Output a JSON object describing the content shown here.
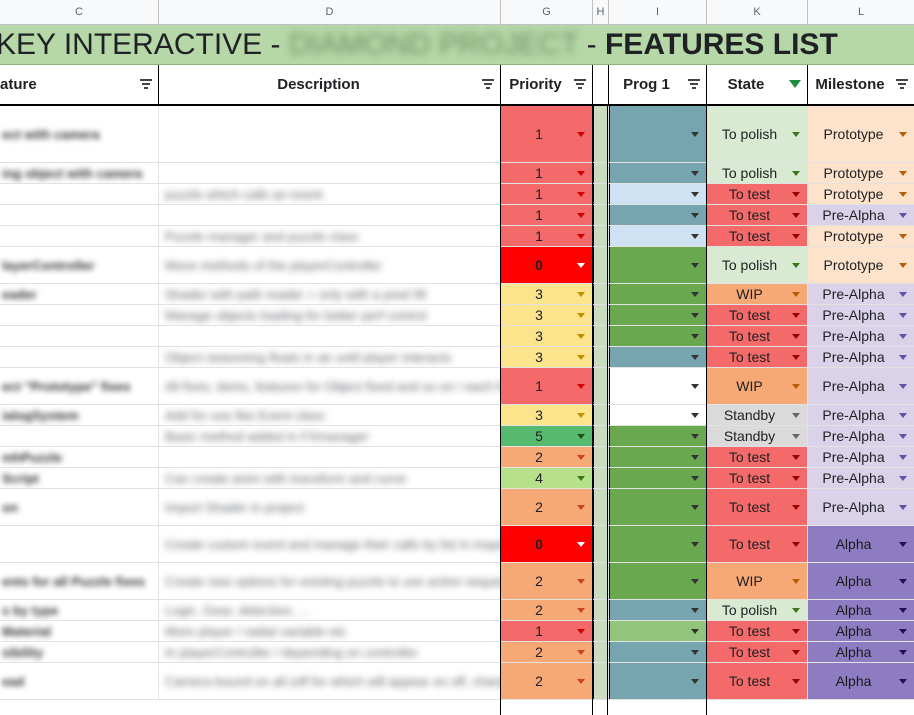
{
  "columns": {
    "letters": [
      "C",
      "D",
      "G",
      "H",
      "I",
      "K",
      "L"
    ]
  },
  "title": {
    "prefix": "KEY INTERACTIVE - ",
    "blurred": "DIAMOND PROJECT",
    "suffix_dash": " - ",
    "suffix": "FEATURES LIST"
  },
  "headers": {
    "feature": "ature",
    "description": "Description",
    "priority": "Priority",
    "prog1": "Prog 1",
    "state": "State",
    "milestone": "Milestone"
  },
  "colors": {
    "title_band": "#b6d7a8",
    "priority": {
      "0": "#ff0000",
      "1": "#f46a6a",
      "2": "#f6a875",
      "3": "#fce48c",
      "4": "#b7e08a",
      "5": "#57bb6f"
    },
    "state": {
      "To polish": "#d9ead3",
      "To test": "#f46a6a",
      "WIP": "#f6a875",
      "Standby": "#dadada"
    },
    "milestone": {
      "Prototype": "#fde3cc",
      "Pre-Alpha": "#d9d2e9",
      "Alpha": "#8e7cc3"
    }
  },
  "rows": [
    {
      "feature": "ect with camera",
      "description": "",
      "priority": "1",
      "prog": "teal",
      "state": "To polish",
      "milestone": "Prototype"
    },
    {
      "feature": "ing object with camera",
      "description": "",
      "priority": "1",
      "prog": "teal",
      "state": "To polish",
      "milestone": "Prototype"
    },
    {
      "feature": "",
      "description": "puzzle which calls an event",
      "priority": "1",
      "prog": "light",
      "state": "To test",
      "milestone": "Prototype"
    },
    {
      "feature": "",
      "description": "",
      "priority": "1",
      "prog": "teal",
      "state": "To test",
      "milestone": "Pre-Alpha"
    },
    {
      "feature": "",
      "description": "Puzzle manager and puzzle class",
      "priority": "1",
      "prog": "light",
      "state": "To test",
      "milestone": "Prototype"
    },
    {
      "feature": "layerController",
      "description": "Move methods of the playerController",
      "priority": "0",
      "prog": "green",
      "state": "To polish",
      "milestone": "Prototype"
    },
    {
      "feature": "eader",
      "description": "Shader with path reader + only with a pixel fill",
      "priority": "3",
      "prog": "darkgreen",
      "state": "WIP",
      "milestone": "Pre-Alpha"
    },
    {
      "feature": "",
      "description": "Manage objects loading for better perf control",
      "priority": "3",
      "prog": "darkgreen",
      "state": "To test",
      "milestone": "Pre-Alpha"
    },
    {
      "feature": "",
      "description": "",
      "priority": "3",
      "prog": "darkgreen",
      "state": "To test",
      "milestone": "Pre-Alpha"
    },
    {
      "feature": "",
      "description": "Object seasoning floats in air until player interacts",
      "priority": "3",
      "prog": "teal",
      "state": "To test",
      "milestone": "Pre-Alpha"
    },
    {
      "feature": "ect \"Prototype\" fixes",
      "description": "All fixes, items, features for Object fixed and so on / each feature",
      "priority": "1",
      "prog": "white",
      "state": "WIP",
      "milestone": "Pre-Alpha"
    },
    {
      "feature": "ialogSystem",
      "description": "Add for use like Event class",
      "priority": "3",
      "prog": "none",
      "state": "Standby",
      "milestone": "Pre-Alpha"
    },
    {
      "feature": "",
      "description": "Basic method added in FXmanager",
      "priority": "5",
      "prog": "darkgreen",
      "state": "Standby",
      "milestone": "Pre-Alpha"
    },
    {
      "feature": "mhPuzzle",
      "description": "",
      "priority": "2",
      "prog": "darkgreen",
      "state": "To test",
      "milestone": "Pre-Alpha"
    },
    {
      "feature": "Script",
      "description": "Can create anim with transform and curve",
      "priority": "4",
      "prog": "darkgreen",
      "state": "To test",
      "milestone": "Pre-Alpha"
    },
    {
      "feature": "on",
      "description": "Import Shader in project",
      "priority": "2",
      "prog": "darkgreen",
      "state": "To test",
      "milestone": "Pre-Alpha"
    },
    {
      "feature": "",
      "description": "Create custom event and manage their calls by list in inspector",
      "priority": "0",
      "prog": "green",
      "state": "To test",
      "milestone": "Alpha"
    },
    {
      "feature": "ents for all Puzzle fixes",
      "description": "Create new options for existing puzzle to use action sequences",
      "priority": "2",
      "prog": "green",
      "state": "WIP",
      "milestone": "Alpha"
    },
    {
      "feature": "s by type",
      "description": "Logic, Gear, detection, ...",
      "priority": "2",
      "prog": "teal",
      "state": "To polish",
      "milestone": "Alpha"
    },
    {
      "feature": "Material",
      "description": "More player / radial variable etc",
      "priority": "1",
      "prog": "lightgreen",
      "state": "To test",
      "milestone": "Alpha"
    },
    {
      "feature": "sibility",
      "description": "In playerController / depending on controller",
      "priority": "2",
      "prog": "teal",
      "state": "To test",
      "milestone": "Alpha"
    },
    {
      "feature": "ead",
      "description": "Camera bound on all (off for which will appear on off, change visually depending on the state checking)",
      "priority": "2",
      "prog": "teal",
      "state": "To test",
      "milestone": "Alpha"
    }
  ]
}
